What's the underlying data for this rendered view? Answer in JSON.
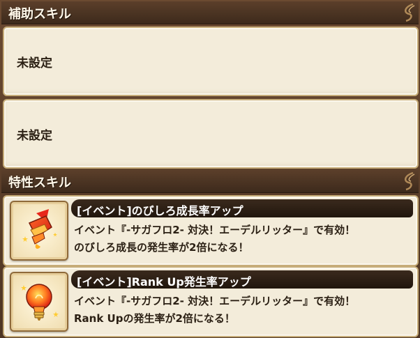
{
  "support_skills": {
    "header": "補助スキル",
    "slots": [
      {
        "label": "未設定"
      },
      {
        "label": "未設定"
      }
    ]
  },
  "trait_skills": {
    "header": "特性スキル",
    "items": [
      {
        "icon": "firework-rocket-icon",
        "name": "[イベント]のびしろ成長率アップ",
        "desc_line1": "イベント『-サガフロ2- 対決！エーデルリッター』で有効！",
        "desc_line2": "のびしろ成長の発生率が2倍になる！"
      },
      {
        "icon": "lightbulb-icon",
        "name": "[イベント]Rank Up発生率アップ",
        "desc_line1": "イベント『-サガフロ2- 対決！エーデルリッター』で有効！",
        "desc_line2": "Rank Upの発生率が2倍になる！"
      }
    ]
  },
  "colors": {
    "header_bg": "#3d2a1c",
    "panel_bg": "#f3ecda",
    "panel_border": "#c6ac78",
    "name_bar": "#21160d"
  }
}
